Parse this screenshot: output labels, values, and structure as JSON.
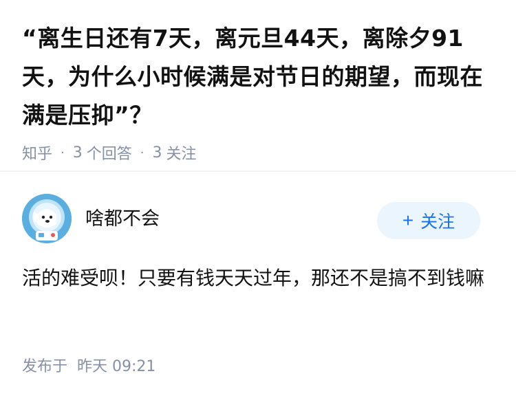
{
  "question": {
    "title": "“离生日还有7天，离元旦44天，离除夕91天，为什么小时候满是对节日的期望，而现在满是压抑”？",
    "source": "知乎",
    "answers_count": "3",
    "answers_label": "个回答",
    "follows_count": "3",
    "follows_label": "关注"
  },
  "answer": {
    "author_name": "啥都不会",
    "follow_button_label": "关注",
    "body": "活的难受呗！只要有钱天天过年，那还不是搞不到钱嘛",
    "time_prefix": "发布于",
    "time_value": "昨天 09:21"
  },
  "colors": {
    "text_primary": "#121212",
    "text_secondary": "#8590a6",
    "accent": "#1772f6",
    "follow_bg": "#ebf5fd",
    "avatar_bg": "#5aaee0"
  },
  "icons": {
    "avatar": "astronaut-dog-avatar",
    "follow": "plus-icon"
  }
}
